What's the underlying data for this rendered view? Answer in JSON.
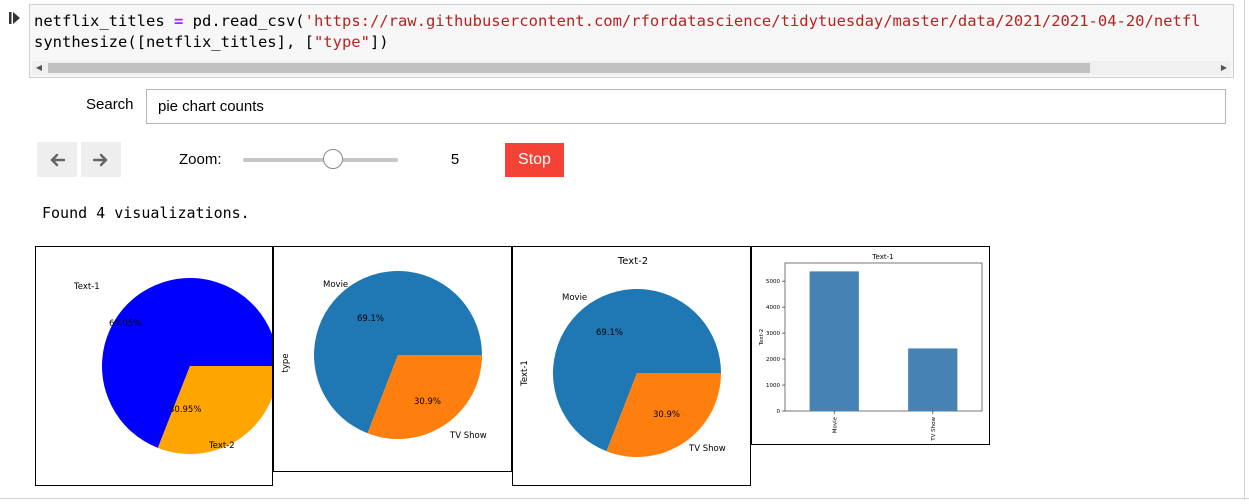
{
  "cell": {
    "code_line1_a": "netflix_titles ",
    "code_line1_op": "=",
    "code_line1_b": " pd.read_csv(",
    "code_line1_str": "'https://raw.githubusercontent.com/rfordatascience/tidytuesday/master/data/2021/2021-04-20/netfl",
    "code_line2_a": "synthesize([netflix_titles], [",
    "code_line2_str": "\"type\"",
    "code_line2_b": "])"
  },
  "search": {
    "label": "Search",
    "value": "pie chart counts"
  },
  "controls": {
    "zoom_label": "Zoom:",
    "zoom_value": "5",
    "zoom_level": 0.58,
    "stop_label": "Stop"
  },
  "results": {
    "found_text": "Found 4 visualizations."
  },
  "chart_data": [
    {
      "type": "pie",
      "labels": [
        "Text-1",
        "Text-2"
      ],
      "values": [
        69.05,
        30.95
      ],
      "pct_labels": [
        "69.05%",
        "30.95%"
      ],
      "colors": [
        "#0000ff",
        "#ffa500"
      ]
    },
    {
      "type": "pie",
      "labels": [
        "Movie",
        "TV Show"
      ],
      "values": [
        69.1,
        30.9
      ],
      "pct_labels": [
        "69.1%",
        "30.9%"
      ],
      "ylabel": "type",
      "colors": [
        "#1f77b4",
        "#ff7f0e"
      ]
    },
    {
      "type": "pie",
      "title": "Text-2",
      "labels": [
        "Movie",
        "TV Show"
      ],
      "values": [
        69.1,
        30.9
      ],
      "pct_labels": [
        "69.1%",
        "30.9%"
      ],
      "ylabel": "Text-1",
      "colors": [
        "#1f77b4",
        "#ff7f0e"
      ]
    },
    {
      "type": "bar",
      "title": "Text-1",
      "categories": [
        "Movie",
        "TV Show"
      ],
      "values": [
        5377,
        2410
      ],
      "ylabel": "Text-2",
      "ylim": [
        0,
        5700
      ],
      "yticks": [
        0,
        1000,
        2000,
        3000,
        4000,
        5000
      ],
      "colors": [
        "#4682b4"
      ]
    }
  ],
  "colors": {
    "stop": "#f44336",
    "code_bg": "#f7f7f7",
    "string": "#ba2121",
    "operator": "#aa22ff"
  },
  "icons": [
    "run-icon",
    "arrow-left-icon",
    "arrow-right-icon",
    "scroll-left-icon",
    "scroll-right-icon"
  ]
}
